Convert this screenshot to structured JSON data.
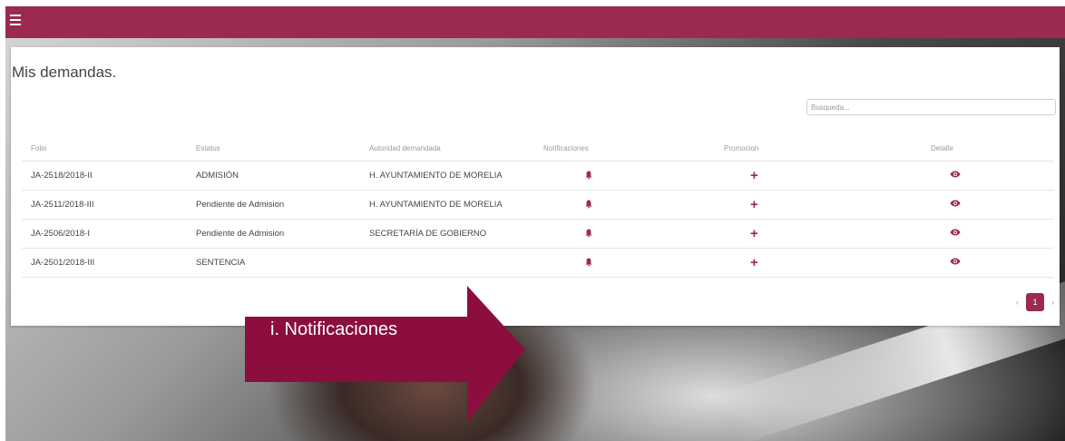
{
  "header": {
    "menu_icon": "hamburger-icon",
    "accent": "#9b2a4f"
  },
  "page": {
    "title": "Mis demandas."
  },
  "search": {
    "placeholder": "Busqueda..."
  },
  "table": {
    "columns": [
      "Folio",
      "Estatus",
      "Autoridad demandada",
      "Notificaciones",
      "Promocion",
      "Detalle"
    ],
    "rows": [
      {
        "folio": "JA-2518/2018-II",
        "estatus": "ADMISIÓN",
        "autoridad": "H. AYUNTAMIENTO DE MORELIA"
      },
      {
        "folio": "JA-2511/2018-III",
        "estatus": "Pendiente de Admision",
        "autoridad": "H. AYUNTAMIENTO DE MORELIA"
      },
      {
        "folio": "JA-2506/2018-I",
        "estatus": "Pendiente de Admision",
        "autoridad": "SECRETARÍA DE GOBIERNO"
      },
      {
        "folio": "JA-2501/2018-III",
        "estatus": "SENTENCIA",
        "autoridad": ""
      }
    ],
    "icons": {
      "notificaciones": "bell-icon",
      "promocion": "plus-icon",
      "detalle": "eye-icon"
    }
  },
  "pagination": {
    "prev": "‹",
    "current": "1",
    "next": "›"
  },
  "callout": {
    "label": "i. Notificaciones",
    "color": "#8b0e3f"
  }
}
